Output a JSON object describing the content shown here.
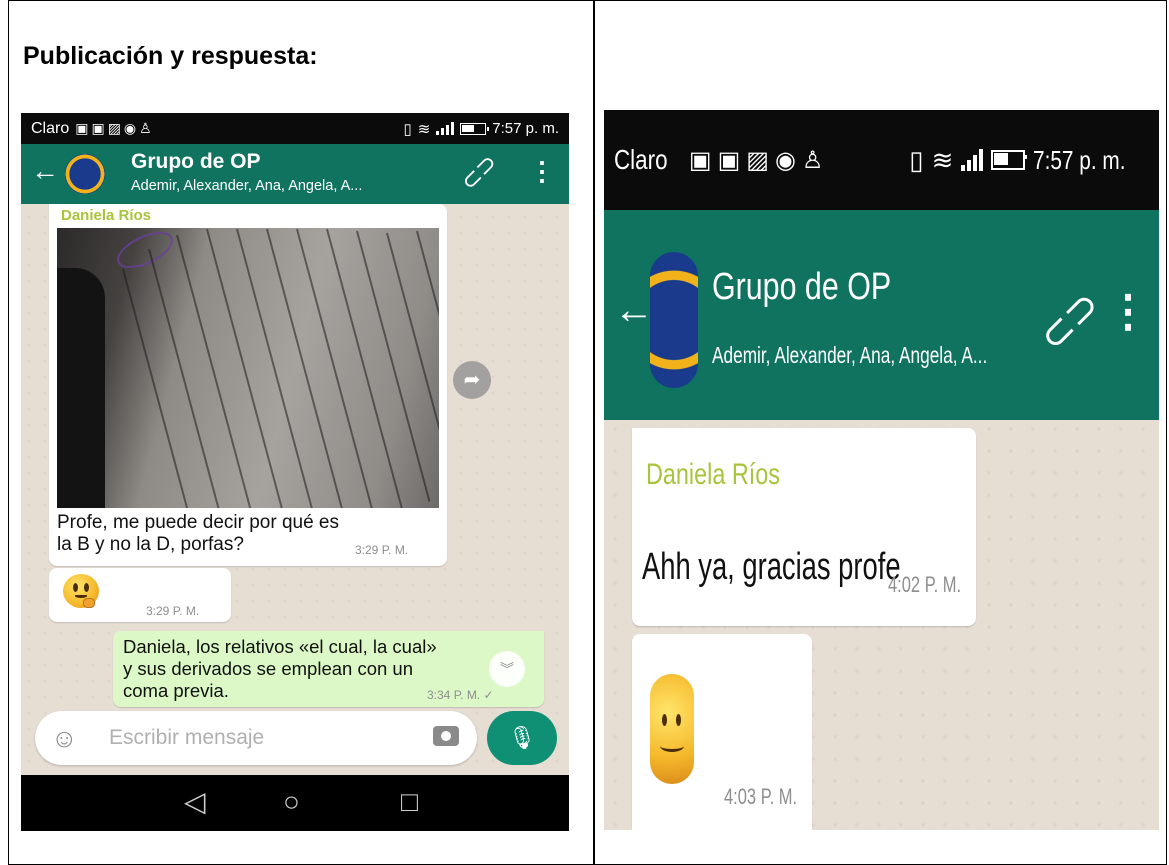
{
  "document": {
    "heading": "Publicación y respuesta:"
  },
  "left_phone": {
    "status_bar": {
      "carrier": "Claro",
      "time": "7:57 p. m."
    },
    "header": {
      "back_icon": "arrow-left-icon",
      "title": "Grupo de OP",
      "subtitle": "Ademir, Alexander, Ana, Angela, A..."
    },
    "messages": [
      {
        "sender": "Daniela Ríos",
        "type": "image",
        "caption": "Profe, me puede decir por qué es la B y no la D, porfas?",
        "caption_line1": "Profe, me puede decir por qué es",
        "caption_line2": "la B y no la D, porfas?",
        "time": "3:29 P. M."
      },
      {
        "type": "emoji",
        "emoji_name": "thinking-face-icon",
        "time": "3:29 P. M."
      },
      {
        "type": "text",
        "direction": "outgoing",
        "line1": "Daniela, los relativos «el cual, la cual»",
        "line2": "y sus derivados se emplean con un",
        "line3": "coma previa.",
        "time": "3:34 P. M. ✓"
      }
    ],
    "input": {
      "placeholder": "Escribir mensaje"
    }
  },
  "right_phone": {
    "status_bar": {
      "carrier": "Claro",
      "time": "7:57 p. m."
    },
    "header": {
      "title": "Grupo de OP",
      "subtitle": "Ademir, Alexander, Ana, Angela, A..."
    },
    "messages": [
      {
        "sender": "Daniela Ríos",
        "text": "Ahh ya, gracias profe",
        "time": "4:02 P. M."
      },
      {
        "type": "emoji",
        "emoji_name": "smiling-face-icon",
        "time": "4:03 P. M."
      }
    ]
  },
  "colors": {
    "header_green": "#0f735f",
    "sender_name": "#a8c43c",
    "outgoing_bubble": "#dcf8c6",
    "chat_background": "#e6ddd3"
  }
}
